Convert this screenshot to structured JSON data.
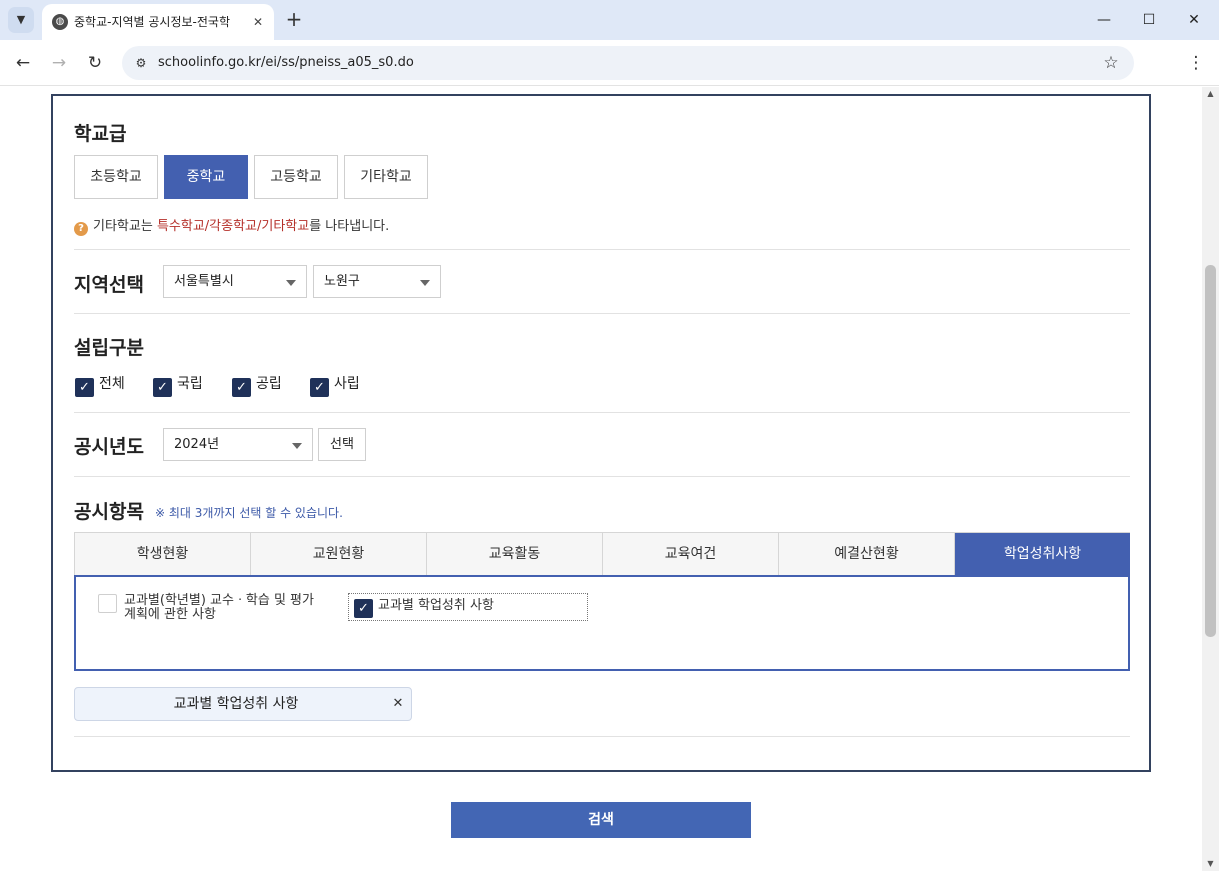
{
  "browser": {
    "tab_title": "중학교-지역별 공시정보-전국학",
    "url": "schoolinfo.go.kr/ei/ss/pneiss_a05_s0.do",
    "icons": {
      "menu": "chevron-down-icon",
      "favicon": "globe-icon",
      "close": "close-icon",
      "new_tab": "plus-icon",
      "back": "arrow-left-icon",
      "forward": "arrow-right-icon",
      "reload": "reload-icon",
      "site": "tune-icon",
      "bookmark": "star-icon",
      "more": "kebab-icon"
    }
  },
  "school_level": {
    "title": "학교급",
    "buttons": [
      {
        "label": "초등학교",
        "active": false
      },
      {
        "label": "중학교",
        "active": true
      },
      {
        "label": "고등학교",
        "active": false
      },
      {
        "label": "기타학교",
        "active": false
      }
    ],
    "help_prefix": "기타학교는 ",
    "help_highlight": "특수학교/각종학교/기타학교",
    "help_suffix": "를 나타냅니다."
  },
  "region": {
    "title": "지역선택",
    "city": "서울특별시",
    "district": "노원구"
  },
  "establishment": {
    "title": "설립구분",
    "options": [
      {
        "label": "전체",
        "checked": true
      },
      {
        "label": "국립",
        "checked": true
      },
      {
        "label": "공립",
        "checked": true
      },
      {
        "label": "사립",
        "checked": true
      }
    ]
  },
  "year": {
    "title": "공시년도",
    "value": "2024년",
    "select_label": "선택"
  },
  "items": {
    "title": "공시항목",
    "note": "※ 최대 3개까지 선택 할 수 있습니다.",
    "tabs": [
      {
        "label": "학생현황",
        "active": false
      },
      {
        "label": "교원현황",
        "active": false
      },
      {
        "label": "교육활동",
        "active": false
      },
      {
        "label": "교육여건",
        "active": false
      },
      {
        "label": "예결산현황",
        "active": false
      },
      {
        "label": "학업성취사항",
        "active": true
      }
    ],
    "options": [
      {
        "label": "교과별(학년별) 교수ㆍ학습 및 평가계획에 관한 사항",
        "checked": false
      },
      {
        "label": "교과별 학업성취 사항",
        "checked": true
      }
    ],
    "selected_tag": "교과별 학업성취 사항"
  },
  "search_label": "검색",
  "colors": {
    "accent": "#4360b0",
    "checkbox": "#1f3159",
    "border": "#33425f",
    "highlight": "#b5302a"
  }
}
